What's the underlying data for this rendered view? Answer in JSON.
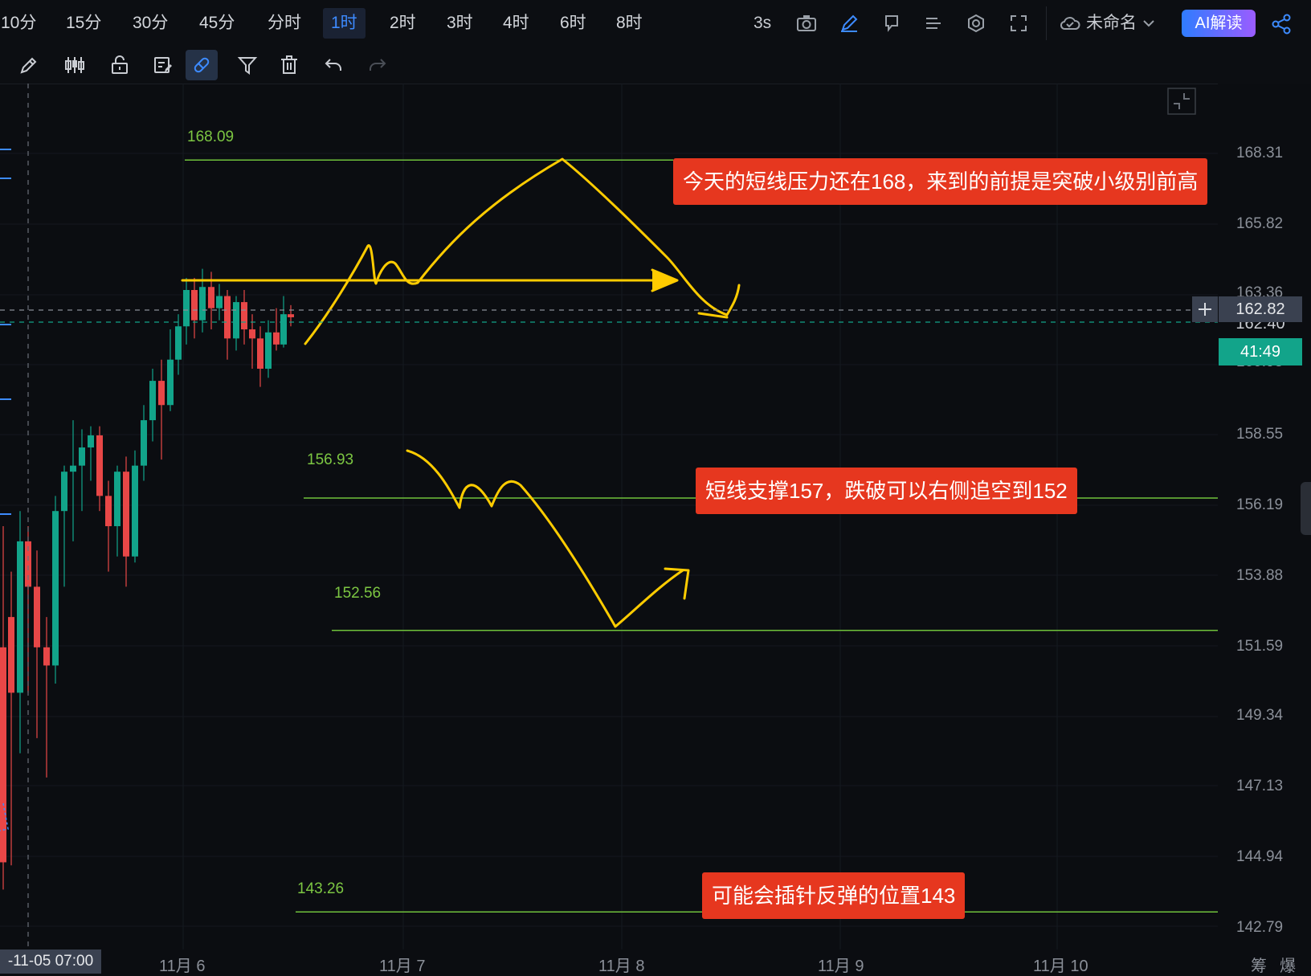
{
  "toolbar": {
    "timeframes": [
      "10分",
      "15分",
      "30分",
      "45分",
      "分时",
      "1时",
      "2时",
      "3时",
      "4时",
      "6时",
      "8时"
    ],
    "active_index": 5,
    "interval": "3s",
    "layout_name": "未命名",
    "ai_label": "AI解读"
  },
  "chart": {
    "price_levels": [
      "168.31",
      "165.82",
      "163.36",
      "162.82",
      "160.93",
      "158.55",
      "156.19",
      "153.88",
      "151.59",
      "149.34",
      "147.13",
      "144.94",
      "142.79"
    ],
    "current_price": "162.82",
    "countdown": "41:49",
    "partial_price_above": "162.40",
    "x_labels": [
      "-11-05 07:00",
      "11月 6",
      "11月 7",
      "11月 8",
      "11月 9",
      "11月 10"
    ],
    "corner_labels": [
      "筹",
      "爆"
    ],
    "lines": {
      "l1": "168.09",
      "l2": "156.93",
      "l3": "152.56",
      "l4": "143.26"
    },
    "notes": {
      "n1": "今天的短线压力还在168，来到的前提是突破小级别前高",
      "n2": "短线支撑157，跌破可以右侧追空到152",
      "n3": "可能会插针反弹的位置143"
    }
  },
  "colors": {
    "up": "#12a48a",
    "down": "#e84747",
    "annotation": "#ffcc00",
    "level": "#6fc13b",
    "note_bg": "#e6371f",
    "accent": "#3d8bff"
  }
}
